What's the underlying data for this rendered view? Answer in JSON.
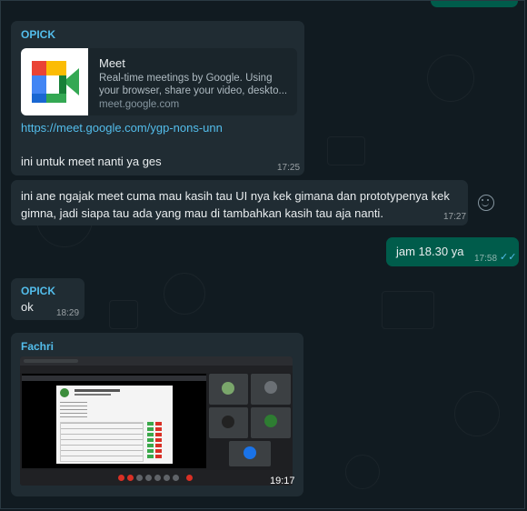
{
  "colors": {
    "wallpaper": "#111b21",
    "incoming_bubble": "#202c33",
    "outgoing_bubble": "#005c4b",
    "sender_opick": "#53bdeb",
    "sender_fachri": "#53bdeb",
    "link": "#53bdeb",
    "read_ticks": "#53bdeb"
  },
  "messages": {
    "m1": {
      "sender": "OPICK",
      "preview_title": "Meet",
      "preview_desc": "Real-time meetings by Google. Using your browser, share your video, deskto...",
      "preview_domain": "meet.google.com",
      "link": "https://meet.google.com/ygp-nons-unn",
      "text": "ini untuk meet nanti ya ges",
      "time": "17:25",
      "thumb_icon": "google-meet-logo"
    },
    "m2": {
      "text": "ini ane ngajak meet cuma mau kasih tau UI nya kek gimana dan prototypenya kek gimna, jadi siapa tau ada yang mau di tambahkan kasih tau aja nanti.",
      "time": "17:27",
      "reaction_icon": "emoji-icon"
    },
    "m3": {
      "text": "jam 18.30 ya",
      "time": "17:58",
      "status_icon": "double-check-icon"
    },
    "m4": {
      "sender": "OPICK",
      "text": "ok",
      "time": "18:29"
    },
    "m5": {
      "sender": "Fachri",
      "time": "19:17",
      "image_icon": "screenshot-image"
    }
  }
}
